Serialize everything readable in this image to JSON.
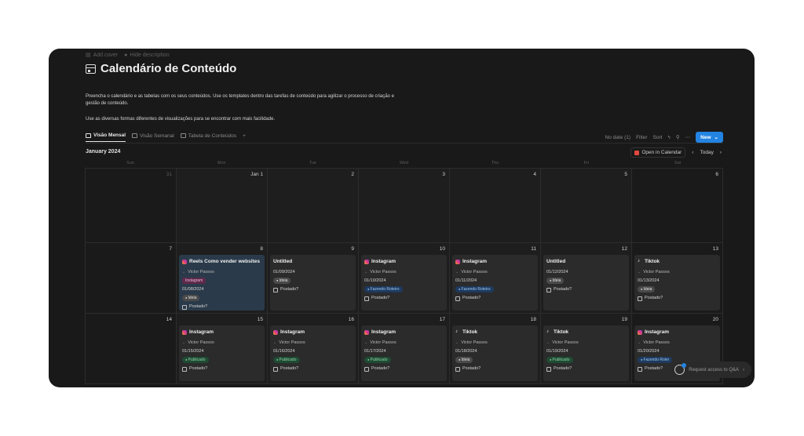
{
  "meta": {
    "add_cover": "Add cover",
    "hide_description": "Hide description"
  },
  "title": "Calendário de Conteúdo",
  "description": [
    "Preencha o calendário e as tabelas com os seus conteúdos. Use os templates dentro das tarefas de conteúdo para agilizar o processo de criação e gestão de conteúdo.",
    "Use as diversas formas diferentes de visualizações para se encontrar com mais facilidade."
  ],
  "tabs": [
    {
      "label": "Visão Mensal",
      "icon": "calendar-icon",
      "active": true
    },
    {
      "label": "Visão Semanal",
      "icon": "calendar-icon",
      "active": false
    },
    {
      "label": "Tabela de Conteúdos",
      "icon": "table-icon",
      "active": false
    }
  ],
  "toolbar": {
    "no_date": "No date (1)",
    "filter": "Filter",
    "sort": "Sort",
    "new": "New"
  },
  "calendar": {
    "month": "January 2024",
    "open_in_calendar": "Open in Calendar",
    "today": "Today",
    "weekdays": [
      "Sun",
      "Mon",
      "Tue",
      "Wed",
      "Thu",
      "Fri",
      "Sat"
    ],
    "days": [
      {
        "num": "31",
        "dim": true
      },
      {
        "num": "Jan 1"
      },
      {
        "num": "2"
      },
      {
        "num": "3"
      },
      {
        "num": "4"
      },
      {
        "num": "5"
      },
      {
        "num": "6"
      },
      {
        "num": "7"
      },
      {
        "num": "8",
        "card": {
          "platform": "instagram",
          "title": "Reels Como vender websites",
          "person": "Victor Passos",
          "tag_platform": "Instagram",
          "date": "01/08/2024",
          "status": "Ideia",
          "status_class": "ideia",
          "check": "Postado?",
          "hl": true
        }
      },
      {
        "num": "9",
        "card": {
          "platform": "none",
          "title": "Untitled",
          "person": "",
          "date": "01/09/2024",
          "status": "Ideia",
          "status_class": "ideia",
          "check": "Postado?"
        }
      },
      {
        "num": "10",
        "card": {
          "platform": "instagram",
          "title": "Instagram",
          "person": "Victor Passos",
          "date": "01/10/2024",
          "status": "Fazendo Roteiro",
          "status_class": "roteiro",
          "check": "Postado?"
        }
      },
      {
        "num": "11",
        "card": {
          "platform": "instagram",
          "title": "Instagram",
          "person": "Victor Passos",
          "date": "01/11/2024",
          "status": "Fazendo Roteiro",
          "status_class": "roteiro",
          "check": "Postado?"
        }
      },
      {
        "num": "12",
        "card": {
          "platform": "none",
          "title": "Untitled",
          "person": "",
          "date": "01/12/2024",
          "status": "Ideia",
          "status_class": "ideia",
          "check": "Postado?"
        }
      },
      {
        "num": "13",
        "card": {
          "platform": "tiktok",
          "title": "Tiktok",
          "person": "Victor Passos",
          "date": "01/13/2024",
          "status": "Ideia",
          "status_class": "ideia",
          "check": "Postado?"
        }
      },
      {
        "num": "14"
      },
      {
        "num": "15",
        "card": {
          "platform": "instagram",
          "title": "Instagram",
          "person": "Victor Passos",
          "date": "01/15/2024",
          "status": "Publicado",
          "status_class": "publicado",
          "check": "Postado?"
        }
      },
      {
        "num": "16",
        "card": {
          "platform": "instagram",
          "title": "Instagram",
          "person": "Victor Passos",
          "date": "01/16/2024",
          "status": "Publicado",
          "status_class": "publicado",
          "check": "Postado?"
        }
      },
      {
        "num": "17",
        "card": {
          "platform": "instagram",
          "title": "Instagram",
          "person": "Victor Passos",
          "date": "01/17/2024",
          "status": "Publicado",
          "status_class": "publicado",
          "check": "Postado?"
        }
      },
      {
        "num": "18",
        "card": {
          "platform": "tiktok",
          "title": "Tiktok",
          "person": "Victor Passos",
          "date": "01/18/2024",
          "status": "Ideia",
          "status_class": "ideia",
          "check": "Postado?"
        }
      },
      {
        "num": "19",
        "card": {
          "platform": "tiktok",
          "title": "Tiktok",
          "person": "Victor Passos",
          "date": "01/19/2024",
          "status": "Publicado",
          "status_class": "publicado",
          "check": "Postado?"
        }
      },
      {
        "num": "20",
        "card": {
          "platform": "instagram",
          "title": "Instagram",
          "person": "Victor Passos",
          "date": "01/20/2024",
          "status": "Fazendo Rotei",
          "status_class": "roteiro",
          "check": "Postado?"
        }
      }
    ]
  },
  "qa_button": "Request access to Q&A"
}
